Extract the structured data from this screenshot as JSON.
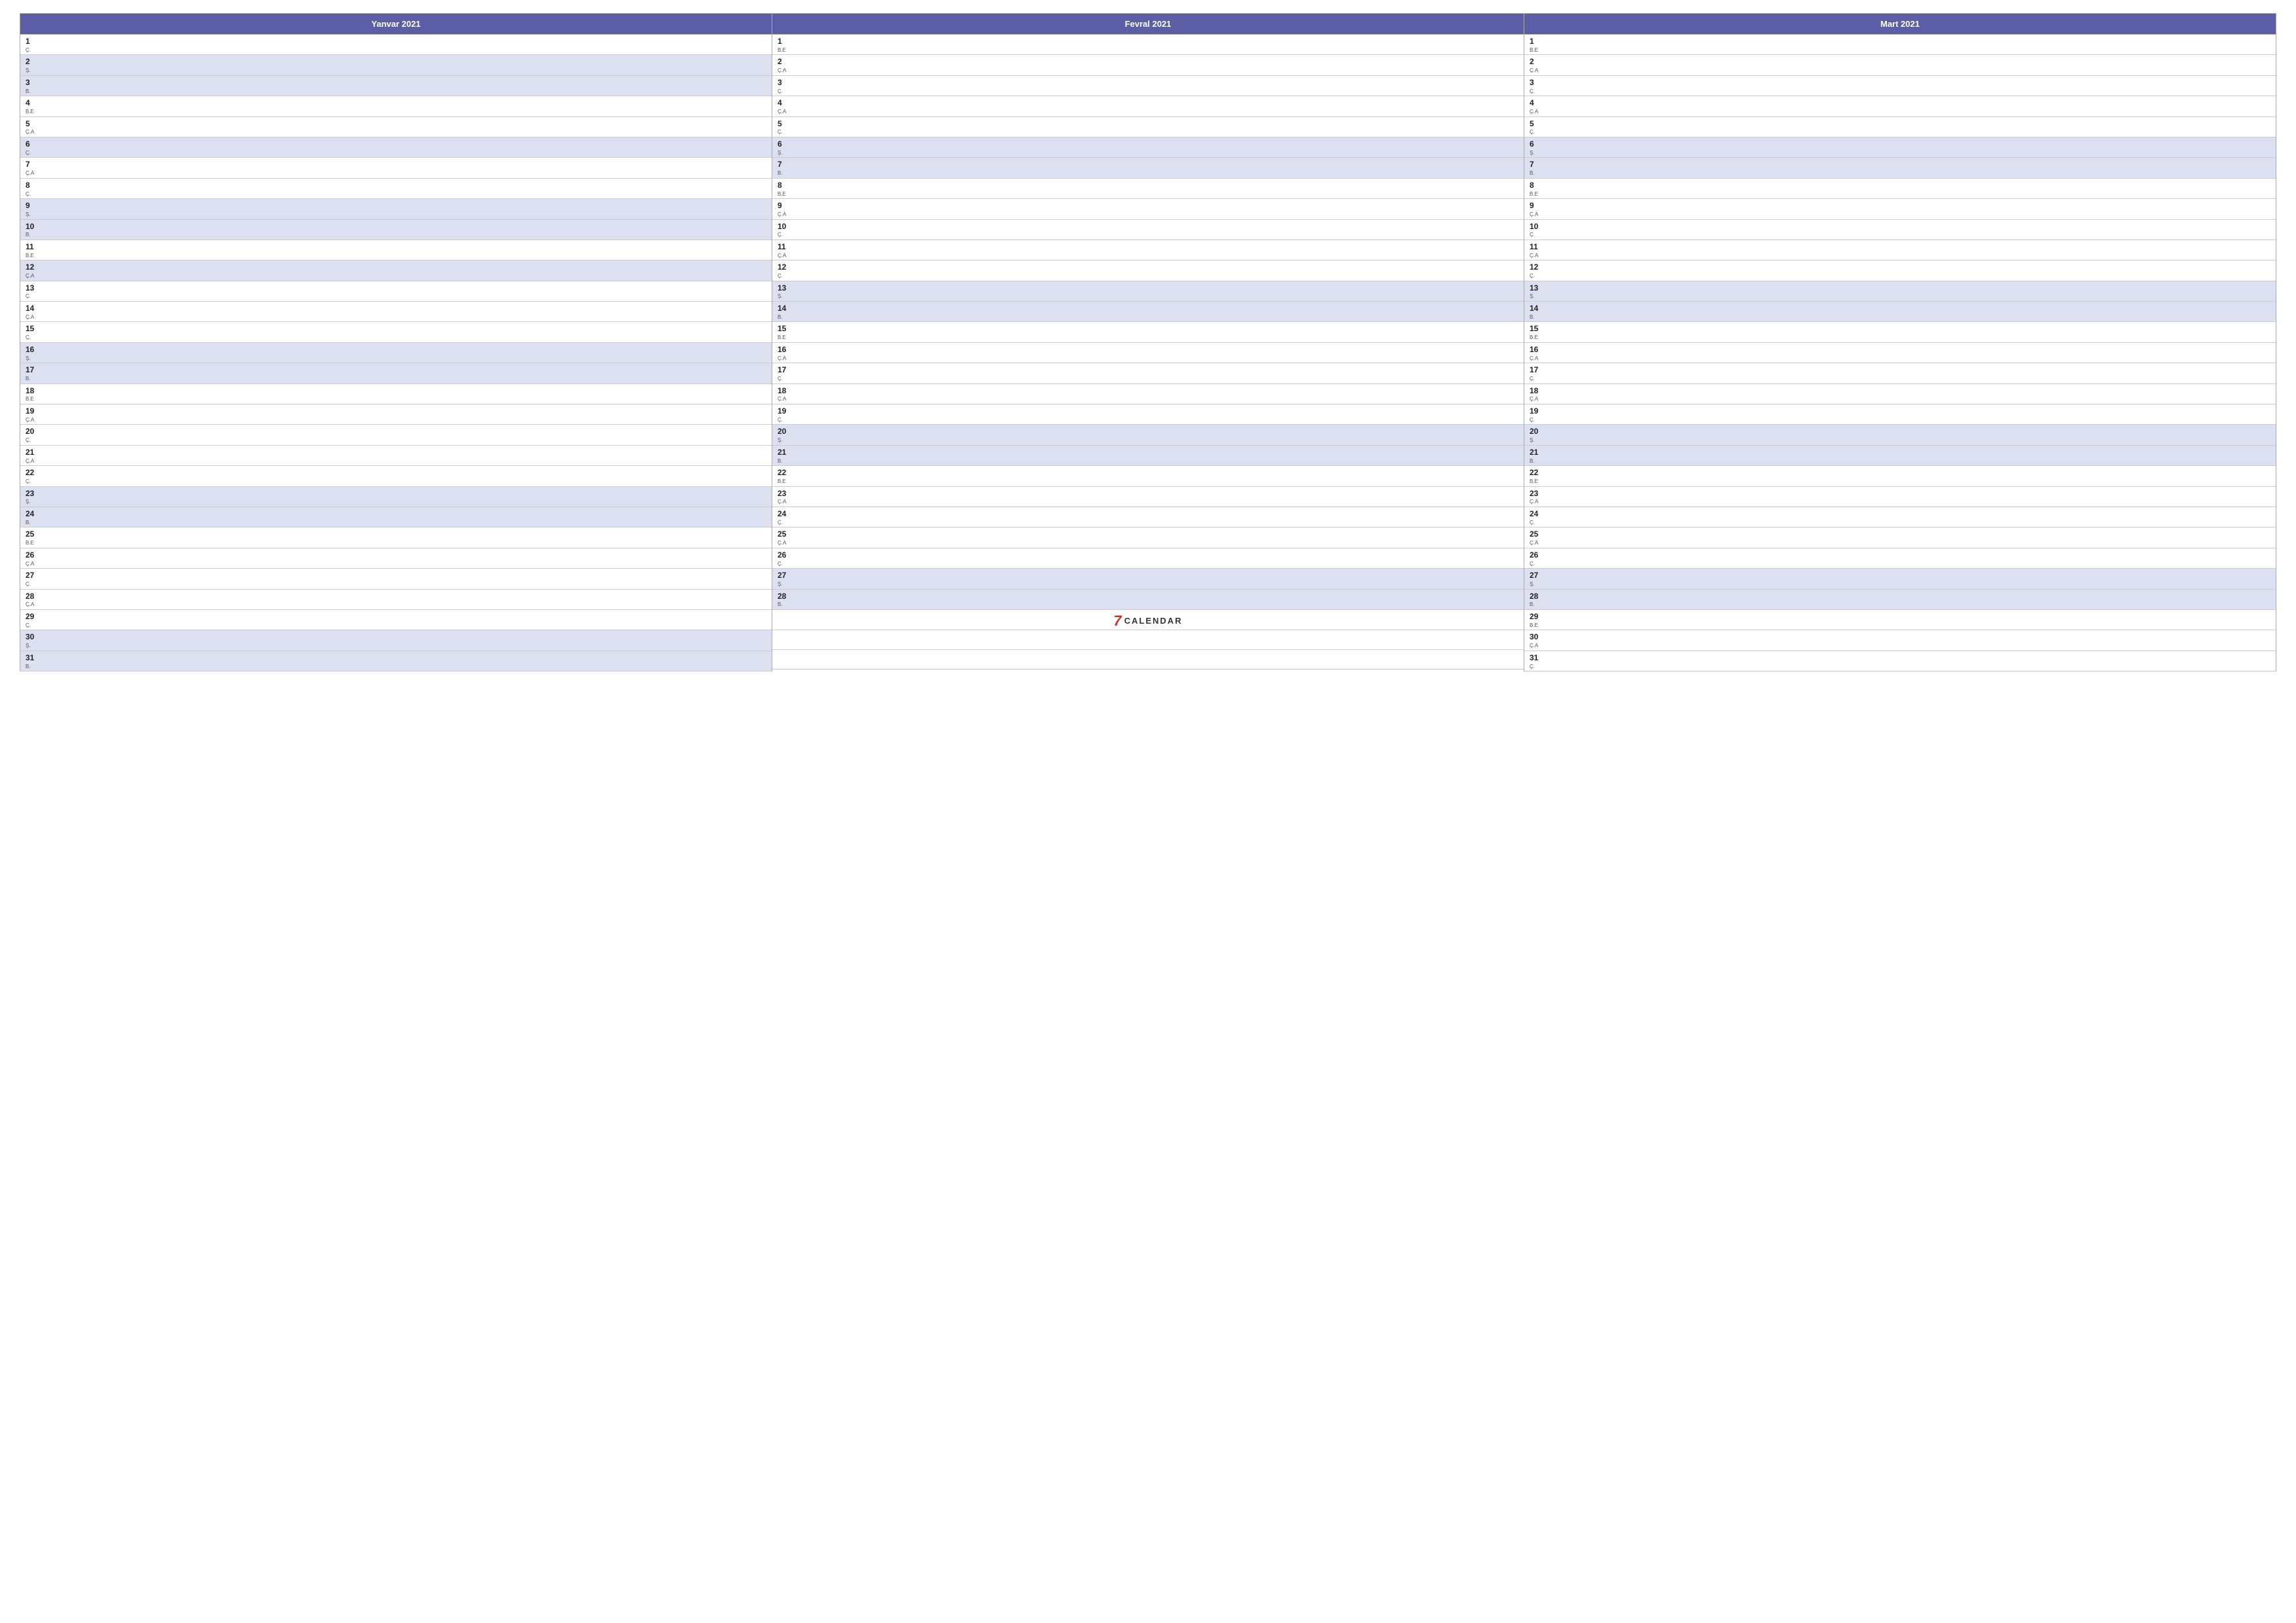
{
  "months": [
    {
      "title": "Yanvar 2021",
      "days": [
        {
          "num": "1",
          "label": "Ç.",
          "shaded": false
        },
        {
          "num": "2",
          "label": "Ş.",
          "shaded": true
        },
        {
          "num": "3",
          "label": "B.",
          "shaded": true
        },
        {
          "num": "4",
          "label": "B.E",
          "shaded": false
        },
        {
          "num": "5",
          "label": "Ç.A",
          "shaded": false
        },
        {
          "num": "6",
          "label": "Ç.",
          "shaded": true
        },
        {
          "num": "7",
          "label": "Ç.A",
          "shaded": false
        },
        {
          "num": "8",
          "label": "Ç.",
          "shaded": false
        },
        {
          "num": "9",
          "label": "Ş.",
          "shaded": true
        },
        {
          "num": "10",
          "label": "B.",
          "shaded": true
        },
        {
          "num": "11",
          "label": "B.E",
          "shaded": false
        },
        {
          "num": "12",
          "label": "Ç.A",
          "shaded": true
        },
        {
          "num": "13",
          "label": "Ç.",
          "shaded": false
        },
        {
          "num": "14",
          "label": "Ç.A",
          "shaded": false
        },
        {
          "num": "15",
          "label": "Ç.",
          "shaded": false
        },
        {
          "num": "16",
          "label": "Ş.",
          "shaded": true
        },
        {
          "num": "17",
          "label": "B.",
          "shaded": true
        },
        {
          "num": "18",
          "label": "B.E",
          "shaded": false
        },
        {
          "num": "19",
          "label": "Ç.A",
          "shaded": false
        },
        {
          "num": "20",
          "label": "Ç.",
          "shaded": false
        },
        {
          "num": "21",
          "label": "Ç.A",
          "shaded": false
        },
        {
          "num": "22",
          "label": "Ç.",
          "shaded": false
        },
        {
          "num": "23",
          "label": "Ş.",
          "shaded": true
        },
        {
          "num": "24",
          "label": "B.",
          "shaded": true
        },
        {
          "num": "25",
          "label": "B.E",
          "shaded": false
        },
        {
          "num": "26",
          "label": "Ç.A",
          "shaded": false
        },
        {
          "num": "27",
          "label": "Ç.",
          "shaded": false
        },
        {
          "num": "28",
          "label": "Ç.A",
          "shaded": false
        },
        {
          "num": "29",
          "label": "Ç.",
          "shaded": false
        },
        {
          "num": "30",
          "label": "Ş.",
          "shaded": true
        },
        {
          "num": "31",
          "label": "B.",
          "shaded": true
        }
      ]
    },
    {
      "title": "Fevral 2021",
      "days": [
        {
          "num": "1",
          "label": "B.E",
          "shaded": false
        },
        {
          "num": "2",
          "label": "Ç.A",
          "shaded": false
        },
        {
          "num": "3",
          "label": "Ç.",
          "shaded": false
        },
        {
          "num": "4",
          "label": "Ç.A",
          "shaded": false
        },
        {
          "num": "5",
          "label": "Ç.",
          "shaded": false
        },
        {
          "num": "6",
          "label": "Ş.",
          "shaded": true
        },
        {
          "num": "7",
          "label": "B.",
          "shaded": true
        },
        {
          "num": "8",
          "label": "B.E",
          "shaded": false
        },
        {
          "num": "9",
          "label": "Ç.A",
          "shaded": false
        },
        {
          "num": "10",
          "label": "Ç.",
          "shaded": false
        },
        {
          "num": "11",
          "label": "Ç.A",
          "shaded": false
        },
        {
          "num": "12",
          "label": "Ç.",
          "shaded": false
        },
        {
          "num": "13",
          "label": "Ş.",
          "shaded": true
        },
        {
          "num": "14",
          "label": "B.",
          "shaded": true
        },
        {
          "num": "15",
          "label": "B.E",
          "shaded": false
        },
        {
          "num": "16",
          "label": "Ç.A",
          "shaded": false
        },
        {
          "num": "17",
          "label": "Ç.",
          "shaded": false
        },
        {
          "num": "18",
          "label": "Ç.A",
          "shaded": false
        },
        {
          "num": "19",
          "label": "Ç.",
          "shaded": false
        },
        {
          "num": "20",
          "label": "Ş.",
          "shaded": true
        },
        {
          "num": "21",
          "label": "B.",
          "shaded": true
        },
        {
          "num": "22",
          "label": "B.E",
          "shaded": false
        },
        {
          "num": "23",
          "label": "Ç.A",
          "shaded": false
        },
        {
          "num": "24",
          "label": "Ç.",
          "shaded": false
        },
        {
          "num": "25",
          "label": "Ç.A",
          "shaded": false
        },
        {
          "num": "26",
          "label": "Ç.",
          "shaded": false
        },
        {
          "num": "27",
          "label": "Ş.",
          "shaded": true
        },
        {
          "num": "28",
          "label": "B.",
          "shaded": true
        }
      ],
      "extra": "logo"
    },
    {
      "title": "Mart 2021",
      "days": [
        {
          "num": "1",
          "label": "B.E",
          "shaded": false
        },
        {
          "num": "2",
          "label": "Ç.A",
          "shaded": false
        },
        {
          "num": "3",
          "label": "Ç.",
          "shaded": false
        },
        {
          "num": "4",
          "label": "Ç.A",
          "shaded": false
        },
        {
          "num": "5",
          "label": "Ç.",
          "shaded": false
        },
        {
          "num": "6",
          "label": "Ş.",
          "shaded": true
        },
        {
          "num": "7",
          "label": "B.",
          "shaded": true
        },
        {
          "num": "8",
          "label": "B.E",
          "shaded": false
        },
        {
          "num": "9",
          "label": "Ç.A",
          "shaded": false
        },
        {
          "num": "10",
          "label": "Ç.",
          "shaded": false
        },
        {
          "num": "11",
          "label": "Ç.A",
          "shaded": false
        },
        {
          "num": "12",
          "label": "Ç.",
          "shaded": false
        },
        {
          "num": "13",
          "label": "Ş.",
          "shaded": true
        },
        {
          "num": "14",
          "label": "B.",
          "shaded": true
        },
        {
          "num": "15",
          "label": "B.E",
          "shaded": false
        },
        {
          "num": "16",
          "label": "Ç.A",
          "shaded": false
        },
        {
          "num": "17",
          "label": "Ç.",
          "shaded": false
        },
        {
          "num": "18",
          "label": "Ç.A",
          "shaded": false
        },
        {
          "num": "19",
          "label": "Ç.",
          "shaded": false
        },
        {
          "num": "20",
          "label": "Ş.",
          "shaded": true
        },
        {
          "num": "21",
          "label": "B.",
          "shaded": true
        },
        {
          "num": "22",
          "label": "B.E",
          "shaded": false
        },
        {
          "num": "23",
          "label": "Ç.A",
          "shaded": false
        },
        {
          "num": "24",
          "label": "Ç.",
          "shaded": false
        },
        {
          "num": "25",
          "label": "Ç.A",
          "shaded": false
        },
        {
          "num": "26",
          "label": "Ç.",
          "shaded": false
        },
        {
          "num": "27",
          "label": "Ş.",
          "shaded": true
        },
        {
          "num": "28",
          "label": "B.",
          "shaded": true
        },
        {
          "num": "29",
          "label": "B.E",
          "shaded": false
        },
        {
          "num": "30",
          "label": "Ç.A",
          "shaded": false
        },
        {
          "num": "31",
          "label": "Ç.",
          "shaded": false
        }
      ]
    }
  ],
  "logo": {
    "number": "7",
    "text": "CALENDAR"
  }
}
